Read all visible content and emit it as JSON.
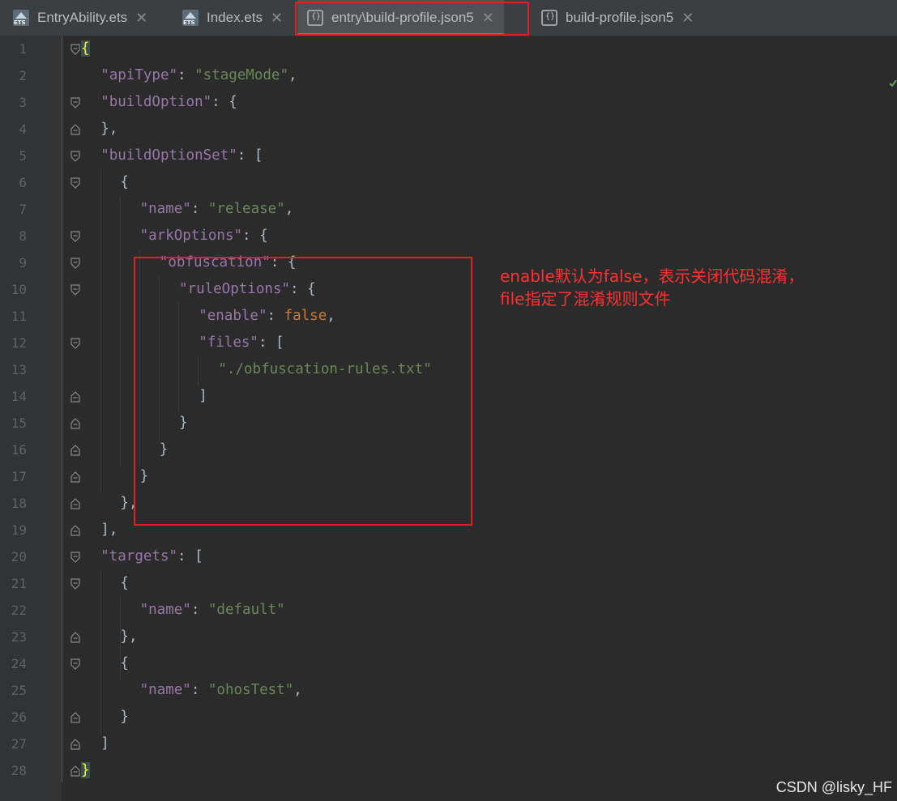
{
  "tabs": [
    {
      "label": "EntryAbility.ets",
      "icon": "ets-file-icon"
    },
    {
      "label": "Index.ets",
      "icon": "ets-file-icon"
    },
    {
      "label": "entry\\build-profile.json5",
      "icon": "json-file-icon",
      "active": true
    },
    {
      "label": "build-profile.json5",
      "icon": "json-file-icon"
    }
  ],
  "lines": [
    [
      [
        "brace",
        "{"
      ]
    ],
    [
      [
        "key",
        "\"apiType\""
      ],
      [
        "p",
        ": "
      ],
      [
        "s",
        "\"stageMode\""
      ],
      [
        "p",
        ","
      ]
    ],
    [
      [
        "key",
        "\"buildOption\""
      ],
      [
        "p",
        ": "
      ],
      [
        "b",
        "{"
      ]
    ],
    [
      [
        "b",
        "}"
      ],
      [
        "p",
        ","
      ]
    ],
    [
      [
        "key",
        "\"buildOptionSet\""
      ],
      [
        "p",
        ": "
      ],
      [
        "b",
        "["
      ]
    ],
    [
      [
        "b",
        "{"
      ]
    ],
    [
      [
        "key",
        "\"name\""
      ],
      [
        "p",
        ": "
      ],
      [
        "s",
        "\"release\""
      ],
      [
        "p",
        ","
      ]
    ],
    [
      [
        "key",
        "\"arkOptions\""
      ],
      [
        "p",
        ": "
      ],
      [
        "b",
        "{"
      ]
    ],
    [
      [
        "key",
        "\"obfuscation\""
      ],
      [
        "p",
        ": "
      ],
      [
        "b",
        "{"
      ]
    ],
    [
      [
        "key",
        "\"ruleOptions\""
      ],
      [
        "p",
        ": "
      ],
      [
        "b",
        "{"
      ]
    ],
    [
      [
        "key",
        "\"enable\""
      ],
      [
        "p",
        ": "
      ],
      [
        "kw",
        "false"
      ],
      [
        "p",
        ","
      ]
    ],
    [
      [
        "key",
        "\"files\""
      ],
      [
        "p",
        ": "
      ],
      [
        "b",
        "["
      ]
    ],
    [
      [
        "s",
        "\"./obfuscation-rules.txt\""
      ]
    ],
    [
      [
        "b",
        "]"
      ]
    ],
    [
      [
        "b",
        "}"
      ]
    ],
    [
      [
        "b",
        "}"
      ]
    ],
    [
      [
        "b",
        "}"
      ]
    ],
    [
      [
        "b",
        "}"
      ],
      [
        "p",
        ","
      ]
    ],
    [
      [
        "b",
        "]"
      ],
      [
        "p",
        ","
      ]
    ],
    [
      [
        "key",
        "\"targets\""
      ],
      [
        "p",
        ": "
      ],
      [
        "b",
        "["
      ]
    ],
    [
      [
        "b",
        "{"
      ]
    ],
    [
      [
        "key",
        "\"name\""
      ],
      [
        "p",
        ": "
      ],
      [
        "s",
        "\"default\""
      ]
    ],
    [
      [
        "b",
        "}"
      ],
      [
        "p",
        ","
      ]
    ],
    [
      [
        "b",
        "{"
      ]
    ],
    [
      [
        "key",
        "\"name\""
      ],
      [
        "p",
        ": "
      ],
      [
        "s",
        "\"ohosTest\""
      ],
      [
        "p",
        ","
      ]
    ],
    [
      [
        "b",
        "}"
      ]
    ],
    [
      [
        "b",
        "]"
      ]
    ],
    [
      [
        "brace",
        "}"
      ]
    ]
  ],
  "annotation": {
    "line1": "enable默认为false，表示关闭代码混淆，",
    "line2": "file指定了混淆规则文件"
  },
  "watermark": "CSDN @lisky_HF",
  "colors": {
    "key": "#9876aa",
    "string": "#6a8759",
    "keyword": "#cc7832",
    "annotation": "#ff3030"
  }
}
